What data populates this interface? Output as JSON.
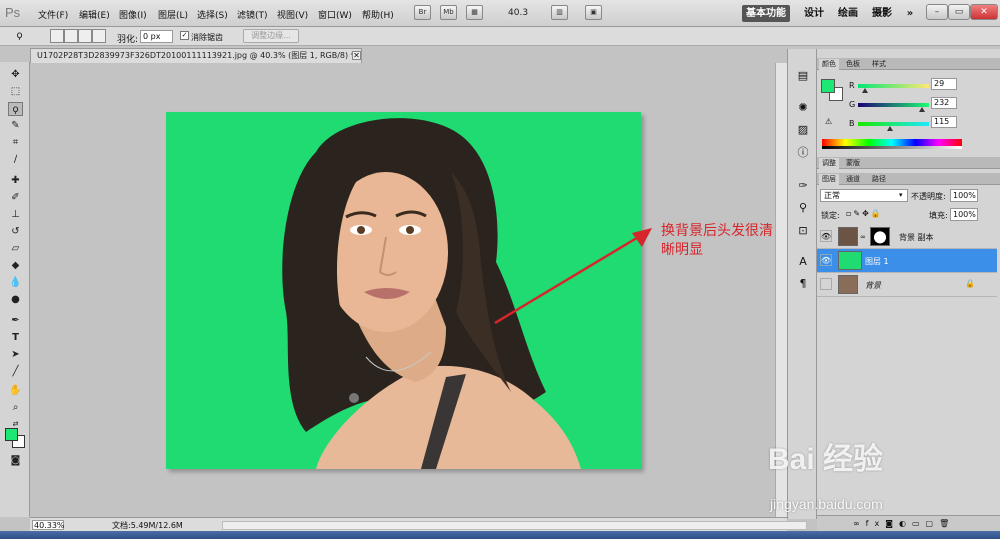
{
  "app": {
    "logo": "Ps"
  },
  "menu": [
    "文件(F)",
    "编辑(E)",
    "图像(I)",
    "图层(L)",
    "选择(S)",
    "滤镜(T)",
    "视图(V)",
    "窗口(W)",
    "帮助(H)"
  ],
  "menubar": {
    "icon_br": "Br",
    "icon_mb": "Mb",
    "zoom": "40.3"
  },
  "workspaces": [
    "基本功能",
    "设计",
    "绘画",
    "摄影"
  ],
  "options": {
    "feather_label": "羽化:",
    "feather_value": "0 px",
    "antialias_label": "消除锯齿",
    "refine_label": "调整边缘..."
  },
  "document": {
    "tab_title": "U1702P28T3D2839973F326DT20100111113921.jpg @ 40.3% (图层 1, RGB/8) *",
    "annotation": "换背景后头发很清晰明显",
    "status_zoom": "40.33%",
    "status_doc": "文档:5.49M/12.6M"
  },
  "color_panel": {
    "tabs": [
      "颜色",
      "色板",
      "样式"
    ],
    "channels": [
      {
        "label": "R",
        "value": "29"
      },
      {
        "label": "G",
        "value": "232"
      },
      {
        "label": "B",
        "value": "115"
      }
    ],
    "fg_color": "#1de873"
  },
  "adjust_tabs": [
    "调整",
    "蒙版"
  ],
  "layers_panel": {
    "tabs": [
      "图层",
      "通道",
      "路径"
    ],
    "blend_mode": "正常",
    "opacity_label": "不透明度:",
    "opacity_value": "100%",
    "lock_label": "锁定:",
    "fill_label": "填充:",
    "fill_value": "100%",
    "layers": [
      {
        "name": "背景 副本",
        "selected": false
      },
      {
        "name": "图层 1",
        "selected": true
      },
      {
        "name": "背景",
        "selected": false
      }
    ]
  },
  "watermark": {
    "brand": "Bai 经验",
    "site": "jingyan.baidu.com"
  },
  "colors": {
    "canvas_green": "#1fdb72",
    "selection_blue": "#3c8fe8",
    "annotation_red": "#d6262c"
  }
}
